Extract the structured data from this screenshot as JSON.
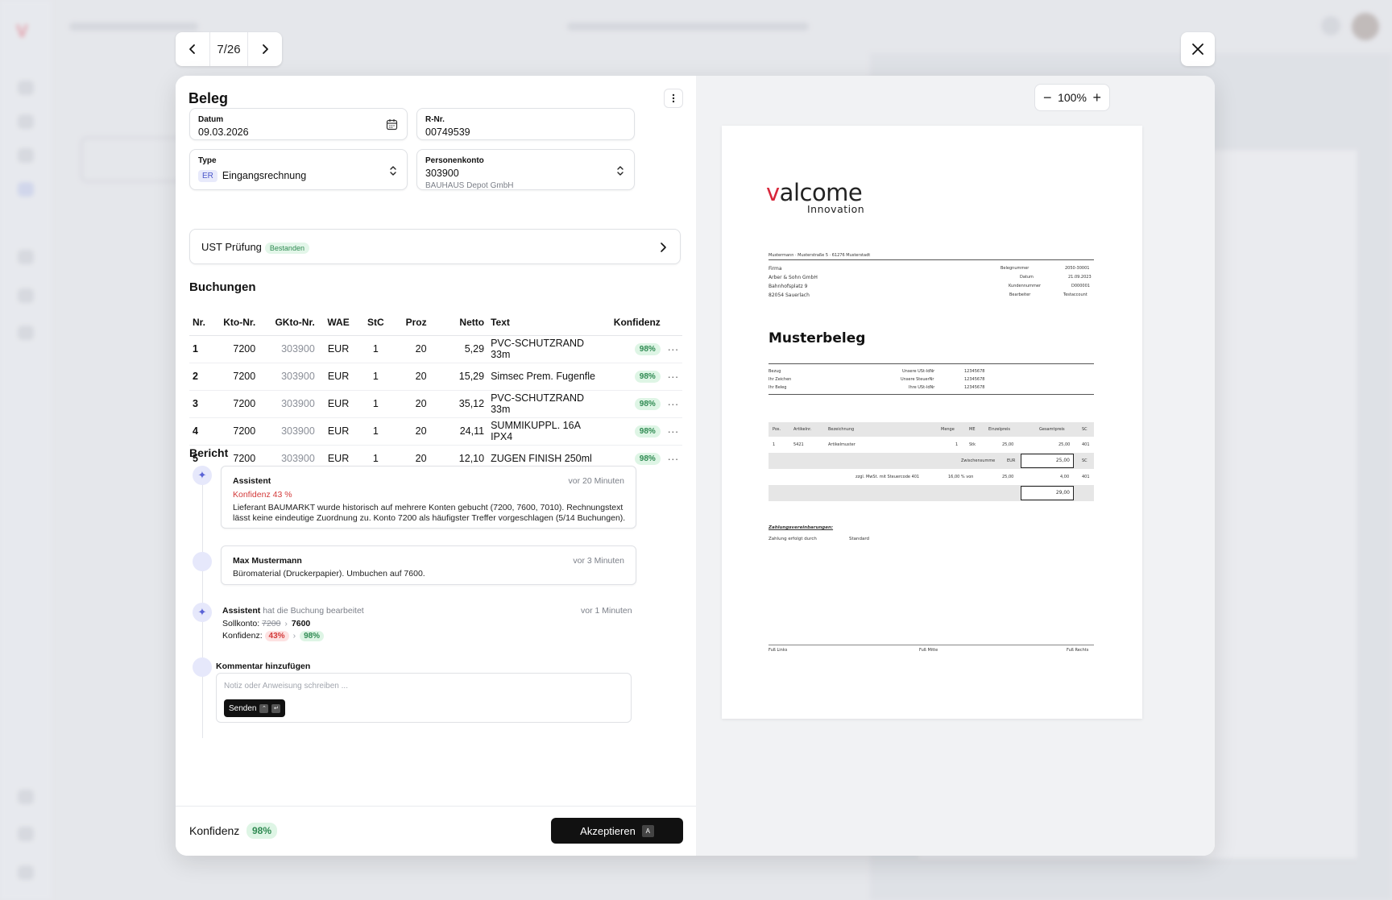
{
  "pager": {
    "counter": "7/26"
  },
  "beleg": {
    "title": "Beleg",
    "datum": {
      "label": "Datum",
      "value": "09.03.2026"
    },
    "rnr": {
      "label": "R-Nr.",
      "value": "00749539"
    },
    "type": {
      "label": "Type",
      "chip": "ER",
      "value": "Eingangsrechnung"
    },
    "personenkonto": {
      "label": "Personenkonto",
      "value": "303900",
      "sub": "BAUHAUS Depot GmbH"
    }
  },
  "ust": {
    "label": "UST Prüfung",
    "badge": "Bestanden"
  },
  "buchungen": {
    "title": "Buchungen",
    "columns": [
      "Nr.",
      "Kto-Nr.",
      "GKto-Nr.",
      "WAE",
      "StC",
      "Proz",
      "Netto",
      "Text",
      "Konfidenz"
    ],
    "rows": [
      {
        "nr": "1",
        "kto": "7200",
        "gkto": "303900",
        "wae": "EUR",
        "stc": "1",
        "proz": "20",
        "netto": "5,29",
        "text": "PVC-SCHUTZRAND 33m",
        "konf": "98%"
      },
      {
        "nr": "2",
        "kto": "7200",
        "gkto": "303900",
        "wae": "EUR",
        "stc": "1",
        "proz": "20",
        "netto": "15,29",
        "text": "Simsec Prem. Fugenfle",
        "konf": "98%"
      },
      {
        "nr": "3",
        "kto": "7200",
        "gkto": "303900",
        "wae": "EUR",
        "stc": "1",
        "proz": "20",
        "netto": "35,12",
        "text": "PVC-SCHUTZRAND 33m",
        "konf": "98%"
      },
      {
        "nr": "4",
        "kto": "7200",
        "gkto": "303900",
        "wae": "EUR",
        "stc": "1",
        "proz": "20",
        "netto": "24,11",
        "text": "SUMMIKUPPL. 16A IPX4",
        "konf": "98%"
      },
      {
        "nr": "5",
        "kto": "7200",
        "gkto": "303900",
        "wae": "EUR",
        "stc": "1",
        "proz": "20",
        "netto": "12,10",
        "text": "ZUGEN FINISH 250ml",
        "konf": "98%"
      }
    ]
  },
  "bericht": {
    "title": "Bericht",
    "entry1": {
      "who": "Assistent",
      "when": "vor 20 Minuten",
      "flag": "Konfidenz 43 %",
      "text": "Lieferant BAUMARKT wurde historisch auf mehrere Konten gebucht (7200, 7600, 7010). Rechnungstext lässt keine eindeutige Zuordnung zu. Konto 7200 als häufigster Treffer vorgeschlagen (5/14 Buchungen)."
    },
    "entry2": {
      "who": "Max Mustermann",
      "when": "vor 3 Minuten",
      "text": "Büromaterial (Druckerpapier). Umbuchen auf 7600."
    },
    "entry3": {
      "who": "Assistent",
      "action": "hat die Buchung bearbeitet",
      "when": "vor 1 Minuten",
      "soll_label": "Sollkonto:",
      "soll_old": "7200",
      "soll_new": "7600",
      "konf_label": "Konfidenz:",
      "konf_old": "43%",
      "konf_new": "98%"
    },
    "comment": {
      "title": "Kommentar hinzufügen",
      "placeholder": "Notiz oder Anweisung schreiben ...",
      "send": "Senden"
    }
  },
  "footer": {
    "label": "Konfidenz",
    "value": "98%",
    "accept": "Akzeptieren",
    "accept_key": "A"
  },
  "viewer": {
    "zoom": "100%"
  },
  "document": {
    "logo_main": "alcome",
    "logo_v": "v",
    "logo_sub": "Innovation",
    "sender_line": "Mustermann · Musterstraße 5 · 61276 Musterstadt",
    "recipient": [
      "Firma",
      "Arber & Sohn GmbH",
      "Bahnhofsplatz 9",
      "82054 Sauerlach"
    ],
    "meta_labels": [
      "Belegnummer",
      "Datum",
      "Kundennummer",
      "Bearbeiter"
    ],
    "meta_values": [
      "2050-30001",
      "21.09.2023",
      "D000001",
      "Testaccount"
    ],
    "title": "Musterbeleg",
    "ref_labels": [
      "Bezug",
      "Ihr Zeichen",
      "Ihr Beleg"
    ],
    "ref_mid_labels": [
      "Unsere USt-IdNr",
      "Unsere SteuerNr",
      "Ihre USt-IdNr"
    ],
    "ref_mid_values": [
      "12345678",
      "12345678",
      "12345678"
    ],
    "table_head": [
      "Pos.",
      "Artikelnr.",
      "Bezeichnung",
      "Menge",
      "ME",
      "Einzelpreis",
      "Gesamtpreis",
      "SC"
    ],
    "item": [
      "1",
      "5421",
      "Artikelmuster",
      "1",
      "Stk",
      "25,00",
      "25,00",
      "401"
    ],
    "zwischensumme_label": "Zwischensumme",
    "zwischensumme_cur": "EUR",
    "zwischensumme_val": "25,00",
    "zwischensumme_sc": "SC",
    "mwst_label": "zzgl. MwSt. mit Steuercode 401",
    "mwst_rate": "16,00 % von",
    "mwst_base": "25,00",
    "mwst_val": "4,00",
    "mwst_sc": "401",
    "total": "29,00",
    "pay_title": "Zahlungsvereinbarungen:",
    "pay_label": "Zahlung erfolgt durch",
    "pay_value": "Standard",
    "footer_left": "Fuß Links",
    "footer_mid": "Fuß Mitte",
    "footer_right": "Fuß Rechts"
  }
}
